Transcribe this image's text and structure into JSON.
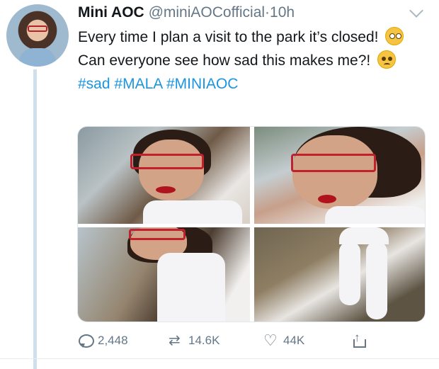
{
  "tweet": {
    "author_name": "Mini AOC",
    "handle": "@miniAOCofficial",
    "separator": "·",
    "time": "10h",
    "text": {
      "part1": "Every time I plan a visit to the park it’s closed!",
      "part2": "Can everyone see how sad this makes me?!",
      "hashtags": [
        "#sad",
        "#MALA",
        "#MINIAOC"
      ]
    },
    "emojis": [
      "flushed-face",
      "frowning-face"
    ],
    "photos": [
      {
        "alt": "girl in red glasses by a chain-link fence"
      },
      {
        "alt": "close-up of girl pouting with red lipstick"
      },
      {
        "alt": "girl looking down near the fence"
      },
      {
        "alt": "girl crouching on the dirt path"
      }
    ]
  },
  "actions": {
    "replies": "2,448",
    "retweets": "14.6K",
    "likes": "44K"
  },
  "colors": {
    "hashtag": "#1b95e0",
    "secondary_text": "#657786",
    "thread_line": "#cfe0ec"
  }
}
